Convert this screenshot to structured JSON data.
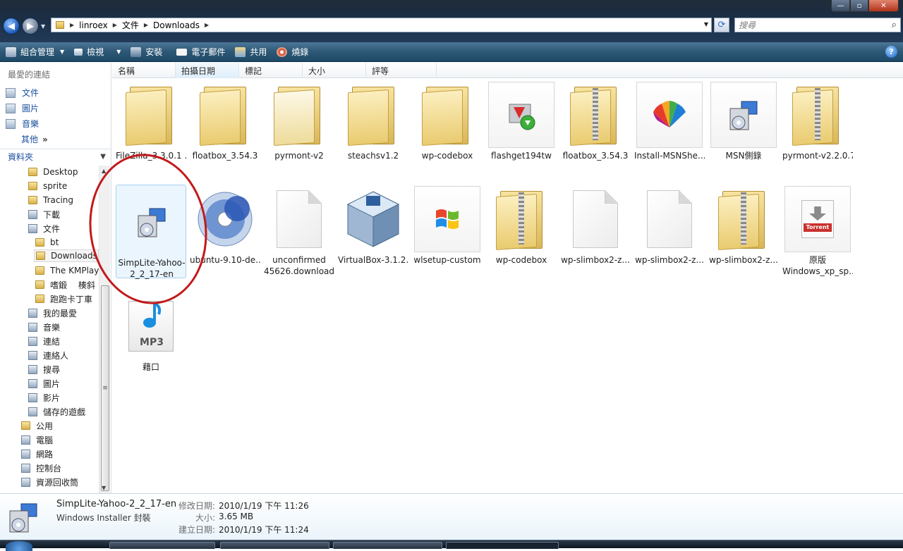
{
  "window": {
    "address": [
      "linroex",
      "文件",
      "Downloads"
    ],
    "search_placeholder": "搜尋"
  },
  "toolbar": {
    "organize": "組合管理",
    "view": "檢視",
    "install": "安裝",
    "email": "電子郵件",
    "share": "共用",
    "burn": "燒錄"
  },
  "sidebar": {
    "favorites_title": "最愛的連結",
    "favorites": [
      "文件",
      "圖片",
      "音樂"
    ],
    "more": "其他",
    "folders_title": "資料夾",
    "tree": [
      "Desktop",
      "sprite",
      "Tracing",
      "下載",
      "文件",
      "bt",
      "Downloads",
      "The KMPlay",
      "嗜鍛　 楱斜",
      "跑跑卡丁車",
      "我的最愛",
      "音樂",
      "連結",
      "連絡人",
      "搜尋",
      "圖片",
      "影片",
      "儲存的遊戲",
      "公用",
      "電腦",
      "網路",
      "控制台",
      "資源回收筒"
    ]
  },
  "columns": [
    "名稱",
    "拍攝日期",
    "標記",
    "大小",
    "評等"
  ],
  "files": [
    {
      "name": "FileZilla_3.3.0.1 ...",
      "kind": "folder"
    },
    {
      "name": "floatbox_3.54.3",
      "kind": "folder"
    },
    {
      "name": "pyrmont-v2",
      "kind": "folder"
    },
    {
      "name": "steachsv1.2",
      "kind": "folder"
    },
    {
      "name": "wp-codebox",
      "kind": "folder"
    },
    {
      "name": "flashget194tw",
      "kind": "exe"
    },
    {
      "name": "floatbox_3.54.3",
      "kind": "zip"
    },
    {
      "name": "Install-MSNShe...",
      "kind": "msn"
    },
    {
      "name": "MSN側錄",
      "kind": "installer"
    },
    {
      "name": "pyrmont-v2.2.0.7",
      "kind": "zip"
    },
    {
      "name": "SimpLite-Yahoo-2_2_17-en",
      "kind": "installer"
    },
    {
      "name": "ubuntu-9.10-de...",
      "kind": "iso"
    },
    {
      "name": "unconfirmed 45626.download",
      "kind": "file"
    },
    {
      "name": "VirtualBox-3.1.2...",
      "kind": "vbox"
    },
    {
      "name": "wlsetup-custom",
      "kind": "windows"
    },
    {
      "name": "wp-codebox",
      "kind": "zip"
    },
    {
      "name": "wp-slimbox2-z...",
      "kind": "file"
    },
    {
      "name": "wp-slimbox2-z...",
      "kind": "file"
    },
    {
      "name": "wp-slimbox2-z...",
      "kind": "zip"
    },
    {
      "name": "原版 Windows_xp_sp...",
      "kind": "torrent"
    },
    {
      "name": "藉口",
      "kind": "mp3"
    }
  ],
  "details": {
    "name": "SimpLite-Yahoo-2_2_17-en",
    "type": "Windows Installer 封裝",
    "modified_label": "修改日期:",
    "modified": "2010/1/19 下午 11:26",
    "size_label": "大小:",
    "size": "3.65 MB",
    "created_label": "建立日期:",
    "created": "2010/1/19 下午 11:24"
  },
  "icons": {
    "torrent_text": "Torrent",
    "mp3_text": "MP3"
  }
}
